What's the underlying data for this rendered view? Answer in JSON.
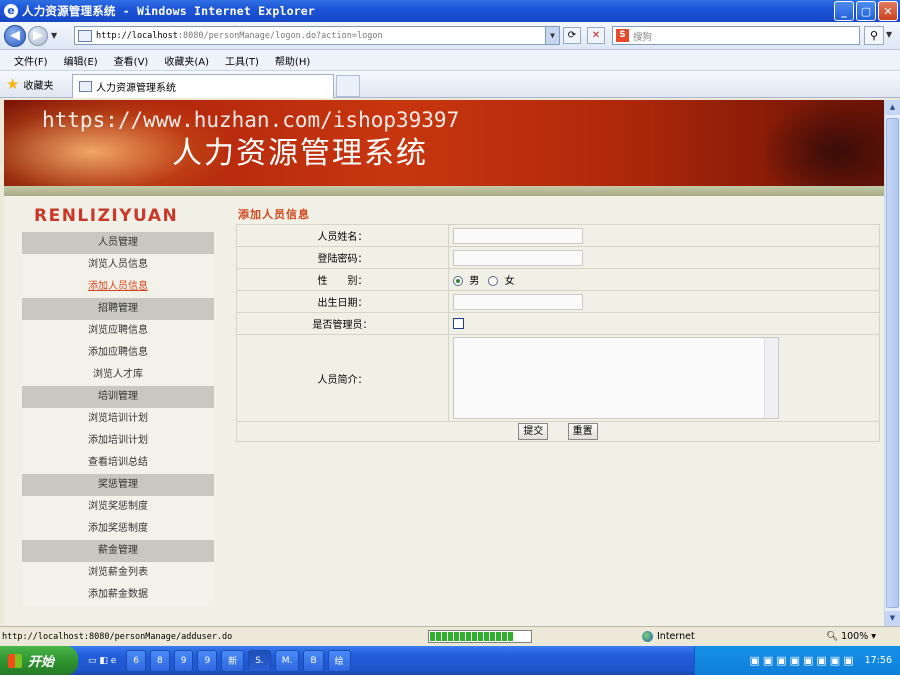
{
  "window": {
    "title": "人力资源管理系统 - Windows Internet Explorer"
  },
  "address": {
    "host": "http://localhost",
    "path": ":8080/personManage/logon.do?action=logon"
  },
  "search": {
    "placeholder": "搜狗"
  },
  "menubar": [
    "文件(F)",
    "编辑(E)",
    "查看(V)",
    "收藏夹(A)",
    "工具(T)",
    "帮助(H)"
  ],
  "favorites": {
    "label": "收藏夹",
    "tab_title": "人力资源管理系统"
  },
  "banner": {
    "watermark": "https://www.huzhan.com/ishop39397",
    "title": "人力资源管理系统"
  },
  "sidebar": {
    "logo": "RENLIZIYUAN",
    "items": [
      {
        "type": "group",
        "label": "人员管理"
      },
      {
        "type": "item",
        "label": "浏览人员信息"
      },
      {
        "type": "item",
        "label": "添加人员信息",
        "active": true
      },
      {
        "type": "group",
        "label": "招聘管理"
      },
      {
        "type": "item",
        "label": "浏览应聘信息"
      },
      {
        "type": "item",
        "label": "添加应聘信息"
      },
      {
        "type": "item",
        "label": "浏览人才库"
      },
      {
        "type": "group",
        "label": "培训管理"
      },
      {
        "type": "item",
        "label": "浏览培训计划"
      },
      {
        "type": "item",
        "label": "添加培训计划"
      },
      {
        "type": "item",
        "label": "查看培训总结"
      },
      {
        "type": "group",
        "label": "奖惩管理"
      },
      {
        "type": "item",
        "label": "浏览奖惩制度"
      },
      {
        "type": "item",
        "label": "添加奖惩制度"
      },
      {
        "type": "group",
        "label": "薪金管理"
      },
      {
        "type": "item",
        "label": "浏览薪金列表"
      },
      {
        "type": "item",
        "label": "添加薪金数据"
      }
    ]
  },
  "form": {
    "title": "添加人员信息",
    "name_label": "人员姓名：",
    "password_label": "登陆密码：",
    "gender_label": "性　　别：",
    "gender_male": "男",
    "gender_female": "女",
    "birth_label": "出生日期：",
    "admin_label": "是否管理员：",
    "intro_label": "人员简介：",
    "submit": "提交",
    "reset": "重置"
  },
  "status": {
    "url": "http://localhost:8080/personManage/adduser.do",
    "zone": "Internet",
    "zoom": "100%"
  },
  "taskbar": {
    "start": "开始",
    "tasks": [
      "6",
      "8",
      "9",
      "9",
      "新",
      "S.",
      "M.",
      "B",
      "绘"
    ],
    "clock": "17:56"
  },
  "colors": {
    "accent": "#d2471c",
    "titlebar": "#1c55d8",
    "banner": "#b3270c"
  }
}
